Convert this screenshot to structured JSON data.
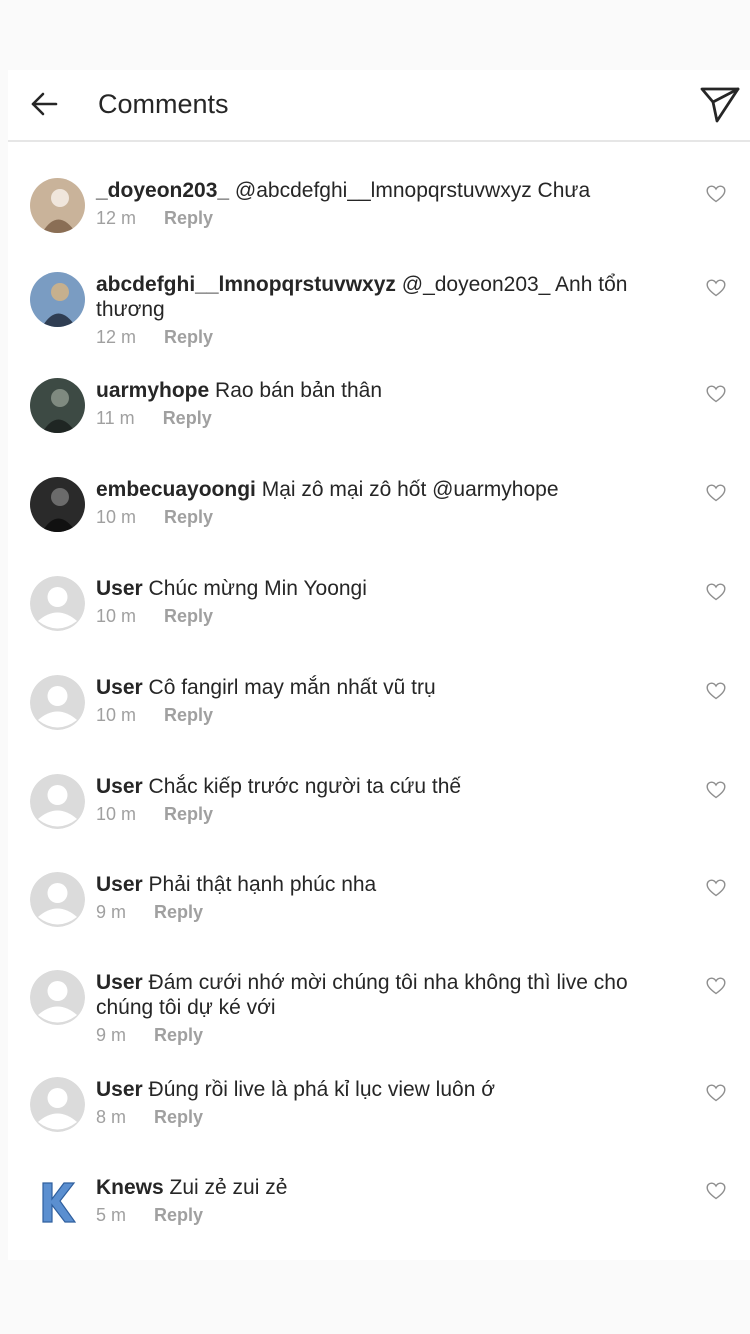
{
  "header": {
    "title": "Comments",
    "back_icon": "arrow-left-icon",
    "share_icon": "paper-plane-icon"
  },
  "comments": [
    {
      "username": "_doyeon203_",
      "text": "@abcdefghi__lmnopqrstuvwxyz Chưa",
      "time": "12 m",
      "reply": "Reply",
      "avatar": "photo"
    },
    {
      "username": "abcdefghi__lmnopqrstuvwxyz",
      "text": "@_doyeon203_ Anh tổn thương",
      "time": "12 m",
      "reply": "Reply",
      "avatar": "photo"
    },
    {
      "username": "uarmyhope",
      "text": "Rao bán bản thân",
      "time": "11 m",
      "reply": "Reply",
      "avatar": "photo"
    },
    {
      "username": "embecuayoongi",
      "text": "Mại zô mại zô hốt @uarmyhope",
      "time": "10 m",
      "reply": "Reply",
      "avatar": "photo"
    },
    {
      "username": "User",
      "text": "Chúc mừng Min Yoongi",
      "time": "10 m",
      "reply": "Reply",
      "avatar": "default"
    },
    {
      "username": "User",
      "text": "Cô fangirl may mắn nhất vũ trụ",
      "time": "10 m",
      "reply": "Reply",
      "avatar": "default"
    },
    {
      "username": "User",
      "text": "Chắc kiếp trước người ta cứu thế",
      "time": "10 m",
      "reply": "Reply",
      "avatar": "default"
    },
    {
      "username": "User",
      "text": "Phải thật hạnh phúc nha",
      "time": "9 m",
      "reply": "Reply",
      "avatar": "default"
    },
    {
      "username": "User",
      "text": "Đám cưới nhớ mời chúng tôi nha không thì live cho chúng tôi dự ké với",
      "time": "9 m",
      "reply": "Reply",
      "avatar": "default"
    },
    {
      "username": "User",
      "text": "Đúng rồi live là phá kỉ lục view luôn ớ",
      "time": "8 m",
      "reply": "Reply",
      "avatar": "default"
    },
    {
      "username": "Knews",
      "text": "Zui zẻ zui zẻ",
      "time": "5 m",
      "reply": "Reply",
      "avatar": "logo-k"
    }
  ],
  "icons": {
    "like": "heart-outline-icon",
    "default_avatar": "default-user-icon"
  },
  "colors": {
    "text": "#262626",
    "muted": "#a0a0a0",
    "background": "#ffffff",
    "page": "#fafafa"
  }
}
